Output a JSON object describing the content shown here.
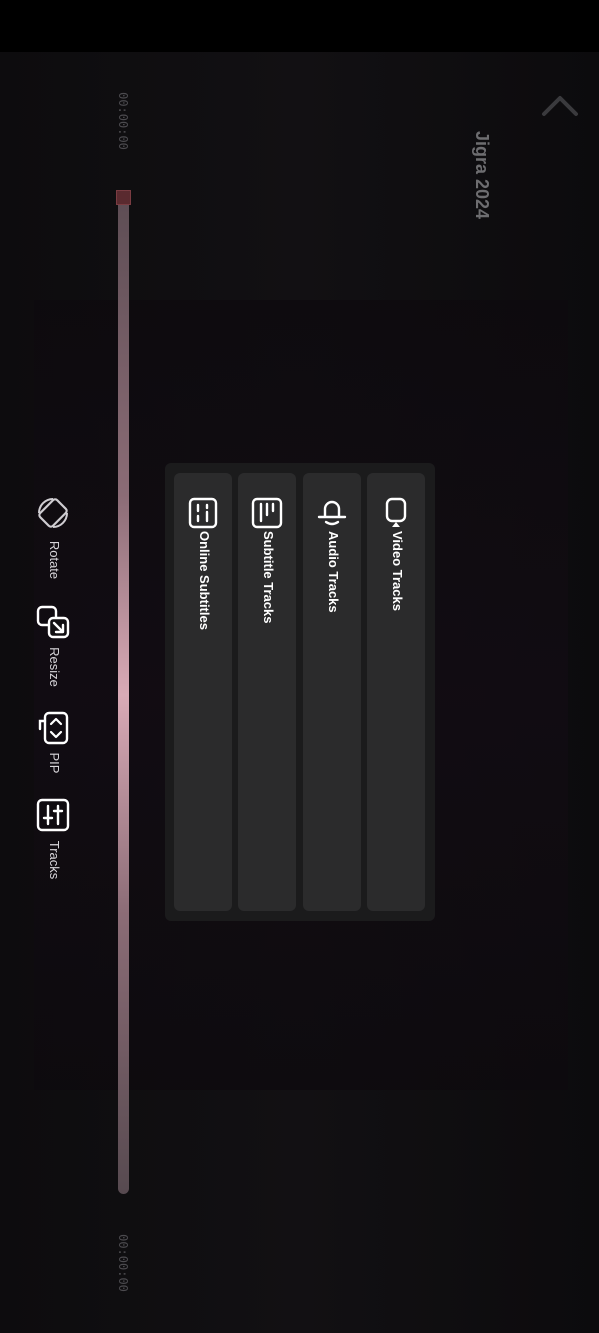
{
  "header": {
    "title": "Jigra 2024",
    "back_icon": "chevron-up-icon"
  },
  "playback": {
    "current_time": "00:00:00",
    "end_time": "00:00:00"
  },
  "tools": [
    {
      "label": "Rotate",
      "icon": "rotate-icon"
    },
    {
      "label": "Resize",
      "icon": "resize-icon"
    },
    {
      "label": "PIP",
      "icon": "pip-icon"
    },
    {
      "label": "Tracks",
      "icon": "tracks-icon"
    }
  ],
  "tracks_menu": [
    {
      "label": "Video Tracks",
      "icon": "video-track-icon"
    },
    {
      "label": "Audio Tracks",
      "icon": "audio-track-icon"
    },
    {
      "label": "Subtitle Tracks",
      "icon": "subtitle-track-icon"
    },
    {
      "label": "Online Subtitles",
      "icon": "online-subtitles-icon"
    }
  ],
  "colors": {
    "accent": "#d9aab6",
    "panel": "#1b1b1c",
    "card": "#2b2b2c",
    "thumb": "#5a2a2f"
  }
}
